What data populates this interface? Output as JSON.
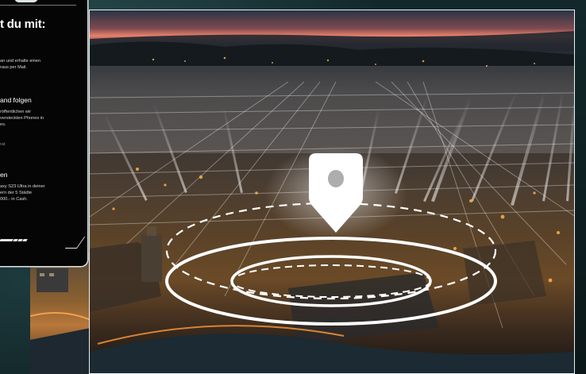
{
  "panel": {
    "title": "t du mit:",
    "step1": {
      "lines": [
        "an und erhalte einen",
        "raus per Mail."
      ]
    },
    "step2": {
      "heading": "and folgen",
      "lines": [
        "röffentlichen wir",
        "versteckten Phones in",
        "es."
      ]
    },
    "step2_muted": "rat",
    "step3": {
      "heading": "en",
      "lines": [
        "axy S23 Ultra in deiner",
        "ern der 5 Städte",
        "000.- in Cash."
      ]
    }
  },
  "colors": {
    "accent": "#ffffff",
    "panel_bg": "#050505",
    "frame": "#e9f2f2"
  },
  "icons": {
    "map_pin": "map-pin-icon"
  }
}
